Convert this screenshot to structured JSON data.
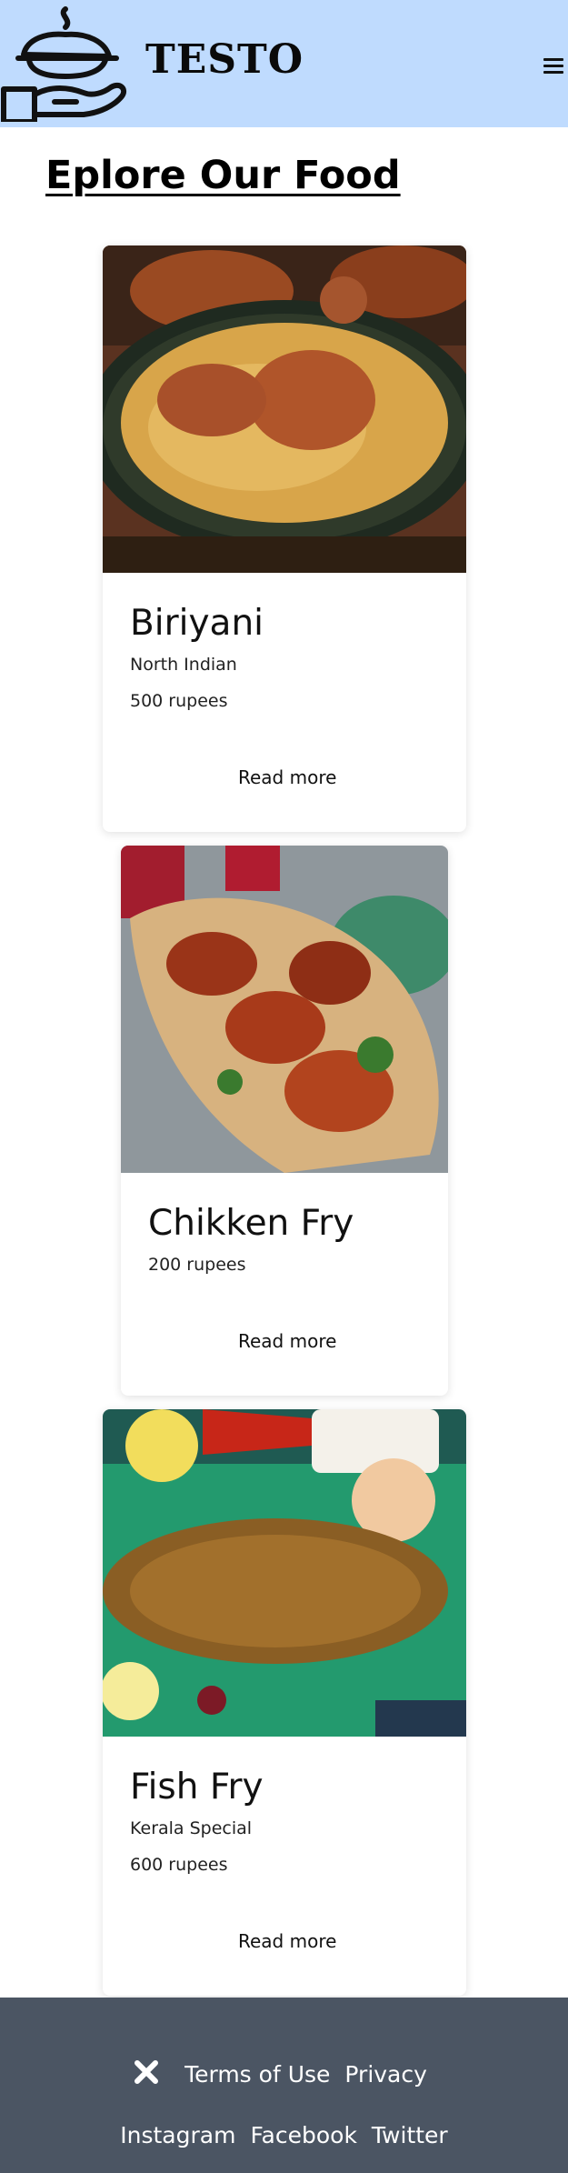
{
  "header": {
    "brand": "TESTO",
    "logo_icon": "food-dish-icon",
    "menu_icon": "hamburger-menu-icon",
    "background": "#bfdbfe"
  },
  "main": {
    "section_title": "Eplore Our Food",
    "cards": [
      {
        "title": "Biriyani",
        "subtitle": "North Indian",
        "price": "500 rupees",
        "cta": "Read more"
      },
      {
        "title": "Chikken Fry",
        "price": "200 rupees",
        "cta": "Read more"
      },
      {
        "title": "Fish Fry",
        "subtitle": "Kerala Special",
        "price": "600 rupees",
        "cta": "Read more"
      }
    ]
  },
  "footer": {
    "icon": "close-x-icon",
    "links_row1": [
      "Terms of Use",
      "Privacy"
    ],
    "links_row2": [
      "Instagram",
      "Facebook",
      "Twitter"
    ],
    "background": "#4b5563"
  }
}
